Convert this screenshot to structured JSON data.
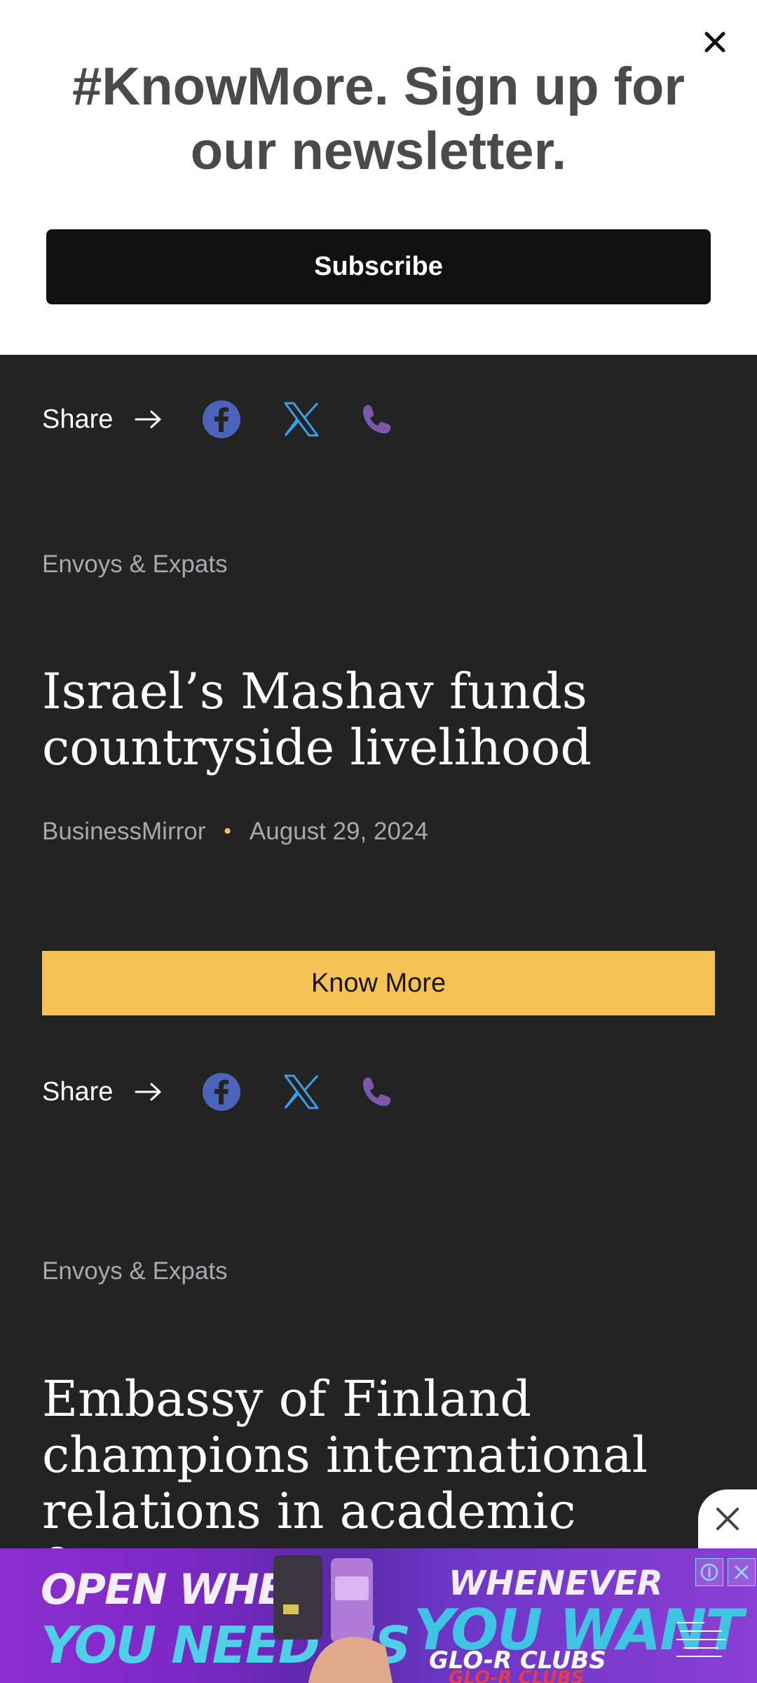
{
  "newsletter": {
    "title": "#KnowMore. Sign up for our newsletter.",
    "subscribe_label": "Subscribe"
  },
  "share": {
    "label": "Share"
  },
  "articles": [
    {
      "category": "Envoys & Expats",
      "headline": "Israel’s Mashav funds countryside livelihood",
      "source": "BusinessMirror",
      "date": "August 29, 2024",
      "know_more_label": "Know More"
    },
    {
      "category": "Envoys & Expats",
      "headline": "Embassy of Finland champions international relations in academic forum"
    }
  ],
  "ad": {
    "line1": "OPEN WHEN",
    "line2": "YOU NEED US",
    "line3": "WHENEVER",
    "line4": "YOU WANT",
    "line5": "GLO-R CLUBS",
    "line6": "GLO-R CLUBS"
  },
  "colors": {
    "accent": "#f6c255",
    "background": "#232324",
    "facebook": "#4b63b8",
    "x": "#3a9fe8",
    "phone": "#7a5aa8"
  }
}
